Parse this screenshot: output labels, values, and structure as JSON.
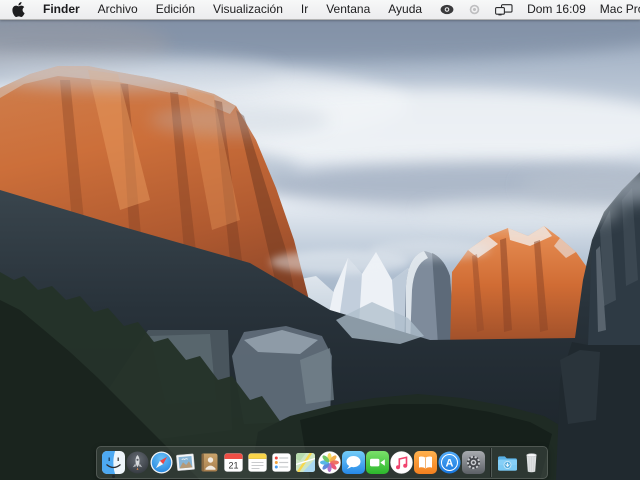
{
  "menu_bar": {
    "apple_icon": "apple-logo",
    "menus": [
      "Finder",
      "Archivo",
      "Edición",
      "Visualización",
      "Ir",
      "Ventana",
      "Ayuda"
    ],
    "active_app_index": 0,
    "status": {
      "clock": "Dom 16:09",
      "device_menu": "Mac Pro",
      "icons": [
        "nvidia-gpu-icon",
        "nvidia-gpu-dim-icon",
        "displays-icon",
        "spotlight-search-icon",
        "notification-center-icon"
      ]
    }
  },
  "desktop": {
    "wallpaper_name": "OS X El Capitan — Yosemite valley at sunset",
    "accent_colors": {
      "cliff_orange": "#c2602f",
      "sky_blue": "#b3c2d3",
      "valley_dark": "#222b31",
      "menubar_light": "#f2f3f4"
    }
  },
  "dock": {
    "calendar_day": "21",
    "items": [
      {
        "name": "finder",
        "icon": "finder-icon",
        "running": true
      },
      {
        "name": "launchpad",
        "icon": "launchpad-icon"
      },
      {
        "name": "safari",
        "icon": "safari-icon"
      },
      {
        "name": "mail",
        "icon": "mail-stamp-icon"
      },
      {
        "name": "contacts",
        "icon": "contacts-icon"
      },
      {
        "name": "calendar",
        "icon": "calendar-icon"
      },
      {
        "name": "notes",
        "icon": "notes-icon"
      },
      {
        "name": "reminders",
        "icon": "reminders-icon"
      },
      {
        "name": "maps",
        "icon": "maps-icon"
      },
      {
        "name": "photos",
        "icon": "photos-pinwheel-icon"
      },
      {
        "name": "messages",
        "icon": "messages-icon"
      },
      {
        "name": "facetime",
        "icon": "facetime-icon"
      },
      {
        "name": "itunes",
        "icon": "itunes-icon"
      },
      {
        "name": "ibooks",
        "icon": "ibooks-icon"
      },
      {
        "name": "app-store",
        "icon": "app-store-icon"
      },
      {
        "name": "system-preferences",
        "icon": "system-preferences-icon"
      },
      {
        "name": "downloads-folder",
        "icon": "downloads-folder-icon"
      },
      {
        "name": "trash",
        "icon": "trash-icon"
      }
    ]
  }
}
